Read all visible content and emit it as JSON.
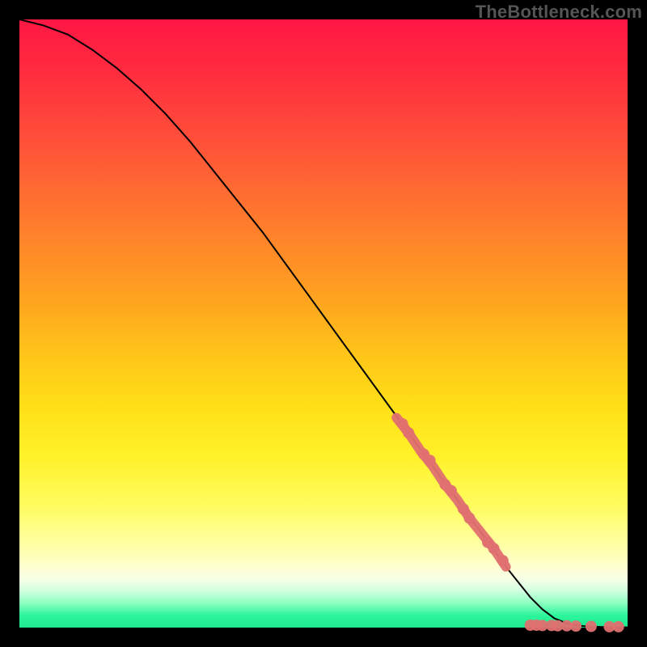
{
  "watermark": "TheBottleneck.com",
  "chart_data": {
    "type": "line",
    "title": "",
    "xlabel": "",
    "ylabel": "",
    "xlim": [
      0,
      100
    ],
    "ylim": [
      0,
      100
    ],
    "grid": false,
    "legend": false,
    "series": [
      {
        "name": "curve",
        "style": "line",
        "color": "#000000",
        "x": [
          0,
          4,
          8,
          12,
          16,
          20,
          24,
          28,
          32,
          36,
          40,
          44,
          48,
          52,
          56,
          60,
          64,
          68,
          72,
          76,
          80,
          82,
          84,
          86,
          88,
          90,
          92,
          94,
          96,
          98,
          100
        ],
        "y": [
          100,
          99,
          97.5,
          95,
          92,
          88.5,
          84.5,
          80,
          75,
          70,
          65,
          59.5,
          54,
          48.5,
          43,
          37.5,
          32,
          26.5,
          21,
          15.5,
          10,
          7.5,
          5,
          3,
          1.5,
          0.7,
          0.3,
          0.15,
          0.1,
          0.05,
          0.05
        ]
      },
      {
        "name": "highlight-segment",
        "style": "line-thick",
        "color": "#e07070",
        "x": [
          62,
          64,
          66,
          68,
          70,
          72,
          74,
          76,
          78,
          80
        ],
        "y": [
          34.5,
          32,
          29,
          26.5,
          23.5,
          21,
          18,
          15.5,
          13,
          10
        ]
      },
      {
        "name": "points-on-curve",
        "style": "points",
        "color": "#e07070",
        "x": [
          63,
          64,
          66.5,
          67.5,
          70,
          71,
          73,
          74,
          77,
          78,
          79.5
        ],
        "y": [
          33.5,
          32,
          28.5,
          27.5,
          23.5,
          22.5,
          19.5,
          18,
          14,
          13,
          11
        ]
      },
      {
        "name": "points-baseline",
        "style": "points",
        "color": "#e07070",
        "x": [
          84,
          85,
          86,
          87.5,
          88.5,
          90,
          91.5,
          94,
          97,
          98.5
        ],
        "y": [
          0.4,
          0.4,
          0.35,
          0.35,
          0.3,
          0.3,
          0.25,
          0.2,
          0.15,
          0.15
        ]
      }
    ]
  }
}
